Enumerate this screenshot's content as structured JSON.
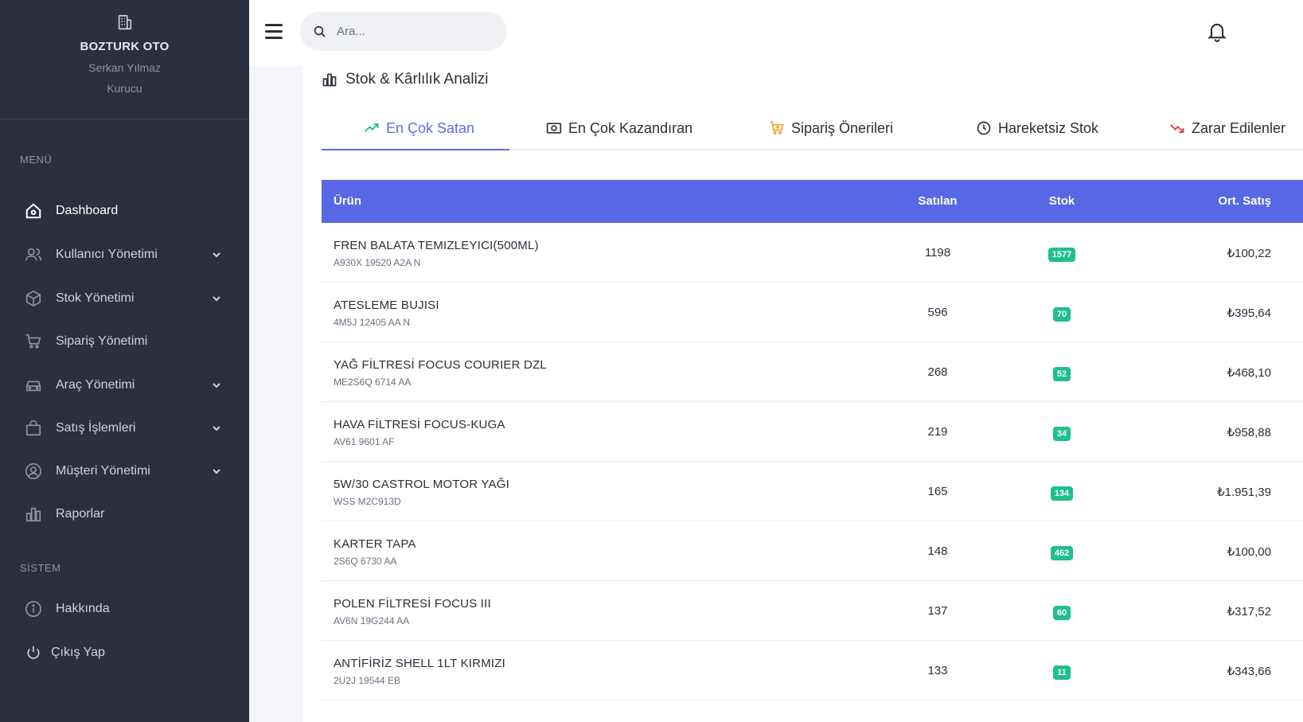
{
  "sidebar": {
    "brand": "BOZTURK OTO",
    "user": "Serkan Yılmaz",
    "role": "Kurucu",
    "menu_label": "MENÜ",
    "system_label": "SİSTEM",
    "items": [
      {
        "label": "Dashboard",
        "icon": "home-icon",
        "active": true,
        "expandable": false
      },
      {
        "label": "Kullanıcı Yönetimi",
        "icon": "users-icon",
        "expandable": true
      },
      {
        "label": "Stok Yönetimi",
        "icon": "box-icon",
        "expandable": true
      },
      {
        "label": "Sipariş Yönetimi",
        "icon": "cart-icon",
        "expandable": false
      },
      {
        "label": "Araç Yönetimi",
        "icon": "car-icon",
        "expandable": true
      },
      {
        "label": "Satış İşlemleri",
        "icon": "bag-icon",
        "expandable": true
      },
      {
        "label": "Müşteri Yönetimi",
        "icon": "user-circle-icon",
        "expandable": true
      },
      {
        "label": "Raporlar",
        "icon": "chart-bar-icon",
        "expandable": false
      }
    ],
    "system_items": [
      {
        "label": "Hakkında",
        "icon": "info-icon"
      },
      {
        "label": "Çıkış Yap",
        "icon": "power-icon"
      }
    ]
  },
  "topbar": {
    "search_placeholder": "Ara..."
  },
  "page": {
    "title": "Stok & Kârlılık Analizi",
    "tabs": [
      {
        "label": "En Çok Satan",
        "icon": "trending-up-icon",
        "active": true
      },
      {
        "label": "En Çok Kazandıran",
        "icon": "money-icon"
      },
      {
        "label": "Sipariş Önerileri",
        "icon": "cart-plus-icon"
      },
      {
        "label": "Hareketsiz Stok",
        "icon": "clock-icon"
      },
      {
        "label": "Zarar Edilenler",
        "icon": "trending-down-icon"
      }
    ]
  },
  "table": {
    "columns": {
      "product": "Ürün",
      "sold": "Satılan",
      "stock": "Stok",
      "avg_price": "Ort. Satış"
    },
    "rows": [
      {
        "name": "FREN BALATA TEMIZLEYICI(500ML)",
        "code": "A930X 19520 A2A N",
        "sold": "1198",
        "stock": "1577",
        "price": "₺100,22"
      },
      {
        "name": "ATESLEME BUJISI",
        "code": "4M5J 12405 AA N",
        "sold": "596",
        "stock": "70",
        "price": "₺395,64"
      },
      {
        "name": "YAĞ FİLTRESİ FOCUS COURIER DZL",
        "code": "ME2S6Q 6714 AA",
        "sold": "268",
        "stock": "52",
        "price": "₺468,10"
      },
      {
        "name": "HAVA FİLTRESİ FOCUS-KUGA",
        "code": "AV61 9601 AF",
        "sold": "219",
        "stock": "34",
        "price": "₺958,88"
      },
      {
        "name": "5W/30 CASTROL MOTOR YAĞI",
        "code": "WSS M2C913D",
        "sold": "165",
        "stock": "134",
        "price": "₺1.951,39"
      },
      {
        "name": "KARTER TAPA",
        "code": "2S6Q 6730 AA",
        "sold": "148",
        "stock": "462",
        "price": "₺100,00"
      },
      {
        "name": "POLEN FİLTRESİ FOCUS III",
        "code": "AV6N 19G244 AA",
        "sold": "137",
        "stock": "60",
        "price": "₺317,52"
      },
      {
        "name": "ANTİFİRİZ SHELL 1LT KIRMIZI",
        "code": "2U2J 19544 EB",
        "sold": "133",
        "stock": "11",
        "price": "₺343,66"
      }
    ]
  },
  "colors": {
    "sidebar_bg": "#2b2f40",
    "accent": "#5867e3",
    "badge": "#1fbf8f"
  }
}
